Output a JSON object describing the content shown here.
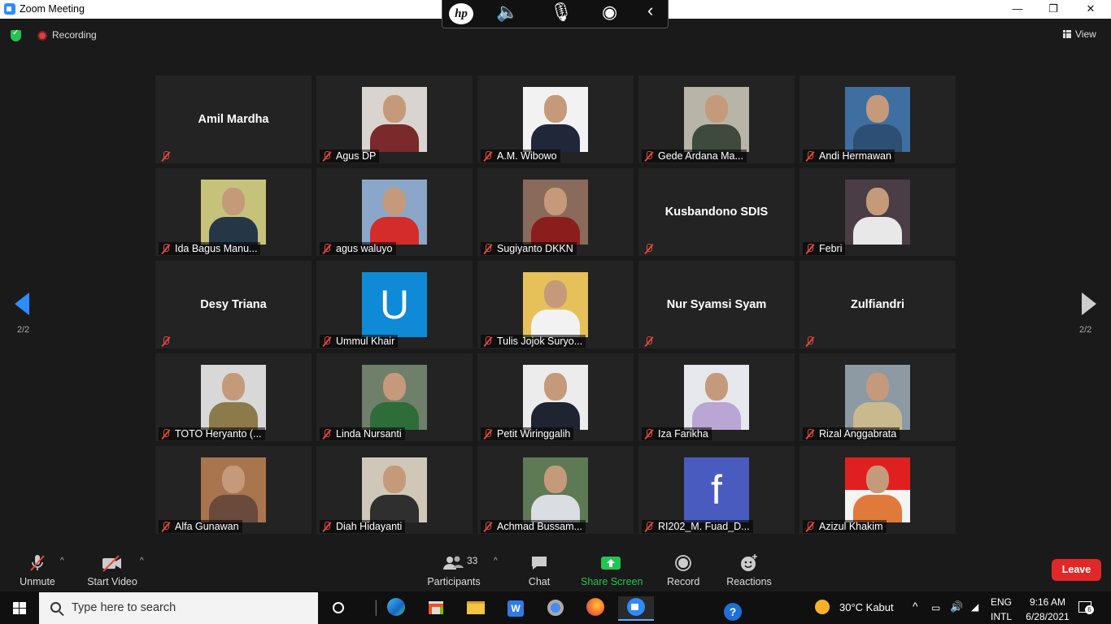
{
  "window": {
    "title": "Zoom Meeting",
    "min": "—",
    "max": "❐",
    "close": "✕"
  },
  "hp_toolbar": {
    "logo": "hp",
    "icons": [
      "speaker-icon",
      "mic-icon",
      "broadcast-icon",
      "collapse-icon"
    ]
  },
  "status": {
    "recording": "Recording",
    "view": "View"
  },
  "pager": {
    "left": "2/2",
    "right": "2/2"
  },
  "participants": [
    {
      "name": "Amil Mardha",
      "video": false
    },
    {
      "name": "Agus DP",
      "video": true,
      "bg": "#d9d4cf",
      "shirt": "#7a2a2a"
    },
    {
      "name": "A.M. Wibowo",
      "video": true,
      "bg": "#f2f2f2",
      "shirt": "#1f2738"
    },
    {
      "name": "Gede Ardana Ma...",
      "video": true,
      "bg": "#b9b4a8",
      "shirt": "#3d4a3d"
    },
    {
      "name": "Andi Hermawan",
      "video": true,
      "bg": "#3f6fa1",
      "shirt": "#2d4f73"
    },
    {
      "name": "Ida Bagus Manu...",
      "video": true,
      "bg": "#c7c27a",
      "shirt": "#253646"
    },
    {
      "name": "agus waluyo",
      "video": true,
      "bg": "#8aa7c9",
      "shirt": "#d42b2b"
    },
    {
      "name": "Sugiyanto DKKN",
      "video": true,
      "bg": "#8a6a5a",
      "shirt": "#8b1d1d"
    },
    {
      "name": "Kusbandono SDIS",
      "video": false
    },
    {
      "name": "Febri",
      "video": true,
      "bg": "#4a3d45",
      "shirt": "#e8e8e8"
    },
    {
      "name": "Desy Triana",
      "video": false
    },
    {
      "name": "Ummul Khair",
      "video": true,
      "letter": "U",
      "bg": "#0e8ad6"
    },
    {
      "name": "Tulis Jojok Suryo...",
      "video": true,
      "bg": "#e6c15a",
      "shirt": "#f2f2f2"
    },
    {
      "name": "Nur Syamsi Syam",
      "video": false
    },
    {
      "name": "Zulfiandri",
      "video": false
    },
    {
      "name": "TOTO Heryanto (...",
      "video": true,
      "bg": "#d8d8d8",
      "shirt": "#8d7a4a"
    },
    {
      "name": "Linda Nursanti",
      "video": true,
      "bg": "#6f7f6a",
      "shirt": "#2e6d3a"
    },
    {
      "name": "Petit Wiringgalih",
      "video": true,
      "bg": "#ececec",
      "shirt": "#1e2430"
    },
    {
      "name": "Iza Farikha",
      "video": true,
      "bg": "#e7e7ee",
      "shirt": "#b9a6d4"
    },
    {
      "name": "Rizal Anggabrata",
      "video": true,
      "bg": "#8d9aa4",
      "shirt": "#c9b98e"
    },
    {
      "name": "Alfa Gunawan",
      "video": true,
      "bg": "#a8754f",
      "shirt": "#6a4a3a"
    },
    {
      "name": "Diah Hidayanti",
      "video": true,
      "bg": "#cfc7b8",
      "shirt": "#2f2f2f"
    },
    {
      "name": "Achmad Bussam...",
      "video": true,
      "bg": "#5d7a55",
      "shirt": "#dadde2"
    },
    {
      "name": "RI202_M. Fuad_D...",
      "video": true,
      "letter": "f",
      "bg": "#4a5bc0"
    },
    {
      "name": "Azizul Khakim",
      "video": true,
      "bg": "#e8e8e8",
      "shirt": "#e07a3a",
      "flag": true
    }
  ],
  "toolbar": {
    "unmute": "Unmute",
    "start_video": "Start Video",
    "participants": "Participants",
    "participants_count": "33",
    "chat": "Chat",
    "share": "Share Screen",
    "record": "Record",
    "reactions": "Reactions",
    "leave": "Leave"
  },
  "taskbar": {
    "search_placeholder": "Type here to search",
    "weather": "30°C  Kabut",
    "lang1": "ENG",
    "lang2": "INTL",
    "time": "9:16 AM",
    "date": "6/28/2021",
    "notif_count": "6"
  },
  "colors": {
    "accent": "#2d8cff",
    "leave": "#e02828",
    "share": "#23c552",
    "muted": "#e0483d"
  }
}
